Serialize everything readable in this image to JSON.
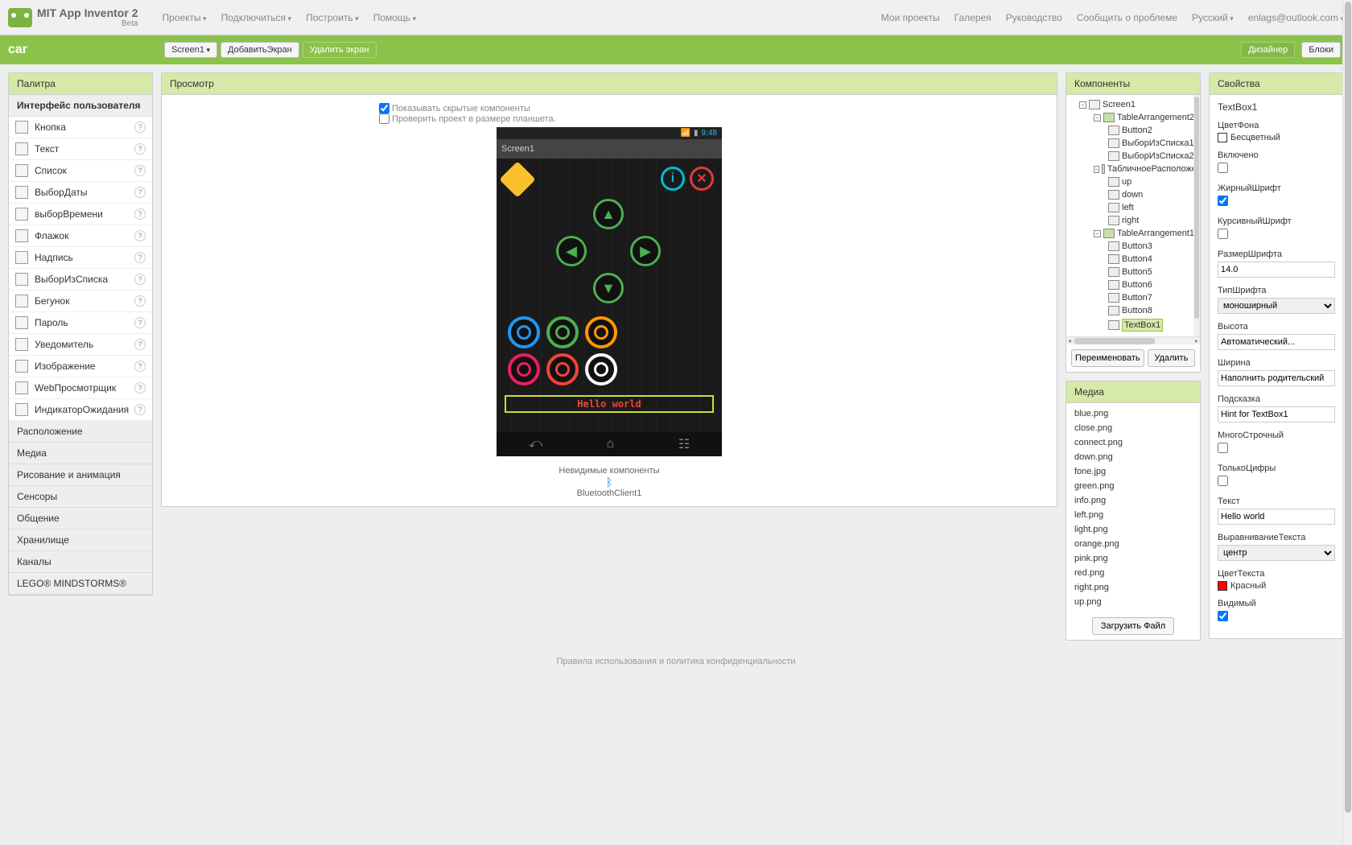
{
  "app": {
    "name": "MIT App Inventor 2",
    "beta": "Beta"
  },
  "menu": [
    "Проекты",
    "Подключиться",
    "Построить",
    "Помощь"
  ],
  "right_menu_plain": [
    "Мои проекты",
    "Галерея",
    "Руководство",
    "Сообщить о проблеме"
  ],
  "right_menu_drop": [
    "Русский",
    "enlags@outlook.com"
  ],
  "project": "car",
  "greenbar": {
    "screen_dropdown": "Screen1",
    "add_screen": "ДобавитьЭкран",
    "remove_screen": "Удалить экран",
    "designer": "Дизайнер",
    "blocks": "Блоки"
  },
  "palette": {
    "header": "Палитра",
    "ui_header": "Интерфейс пользователя",
    "items": [
      "Кнопка",
      "Текст",
      "Список",
      "ВыборДаты",
      "выборВремени",
      "Флажок",
      "Надпись",
      "ВыборИзСписка",
      "Бегунок",
      "Пароль",
      "Уведомитель",
      "Изображение",
      "WebПросмотрщик",
      "ИндикаторОжидания"
    ],
    "cats": [
      "Расположение",
      "Медиа",
      "Рисование и анимация",
      "Сенсоры",
      "Общение",
      "Хранилище",
      "Каналы",
      "LEGO® MINDSTORMS®"
    ]
  },
  "viewer": {
    "header": "Просмотр",
    "show_hidden": "Показывать скрытые компоненты",
    "tablet_size": "Проверить проект в размере планшета.",
    "status_time": "9:48",
    "screen_title": "Screen1",
    "textbox_value": "Hello world",
    "invisible_header": "Невидимые компоненты",
    "bt_client": "BluetoothClient1"
  },
  "components": {
    "header": "Компоненты",
    "tree": {
      "root": "Screen1",
      "ta2": "TableArrangement2",
      "ta2_children": [
        "Button2",
        "ВыборИзСписка1",
        "ВыборИзСписка2"
      ],
      "tl": "ТабличноеРасположе",
      "tl_children": [
        "up",
        "down",
        "left",
        "right"
      ],
      "ta1": "TableArrangement1",
      "ta1_children": [
        "Button3",
        "Button4",
        "Button5",
        "Button6",
        "Button7",
        "Button8"
      ],
      "textbox": "TextBox1"
    },
    "rename": "Переименовать",
    "delete": "Удалить"
  },
  "media": {
    "header": "Медиа",
    "files": [
      "blue.png",
      "close.png",
      "connect.png",
      "down.png",
      "fone.jpg",
      "green.png",
      "info.png",
      "left.png",
      "light.png",
      "orange.png",
      "pink.png",
      "red.png",
      "right.png",
      "up.png"
    ],
    "upload": "Загрузить Файл"
  },
  "properties": {
    "header": "Свойства",
    "component": "TextBox1",
    "bg_label": "ЦветФона",
    "bg_value": "Бесцветный",
    "enabled_label": "Включено",
    "enabled": false,
    "bold_label": "ЖирныйШрифт",
    "bold": true,
    "italic_label": "КурсивныйШрифт",
    "italic": false,
    "fontsize_label": "РазмерШрифта",
    "fontsize": "14.0",
    "typeface_label": "ТипШрифта",
    "typeface": "моноширный",
    "height_label": "Высота",
    "height": "Автоматический...",
    "width_label": "Ширина",
    "width": "Наполнить родительский",
    "hint_label": "Подсказка",
    "hint": "Hint for TextBox1",
    "multiline_label": "МногоСтрочный",
    "multiline": false,
    "numbers_label": "ТолькоЦифры",
    "numbers": false,
    "text_label": "Текст",
    "text": "Hello world",
    "align_label": "ВыравниваниеТекста",
    "align": "центр",
    "color_label": "ЦветТекста",
    "color_value": "Красный",
    "visible_label": "Видимый",
    "visible": true
  },
  "footer": "Правила использования и политика конфиденциальности"
}
